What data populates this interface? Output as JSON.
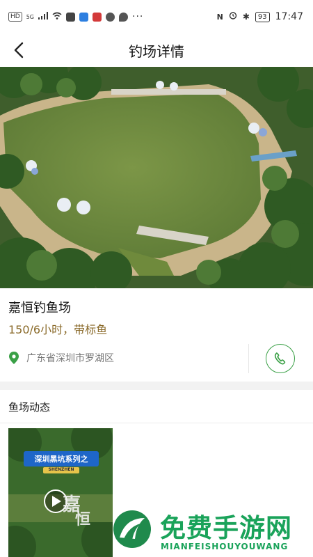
{
  "status_bar": {
    "left_badges": [
      "HD",
      "5G"
    ],
    "battery": "93",
    "time": "17:47"
  },
  "nav": {
    "title": "钓场详情",
    "back_icon": "chevron-left-icon"
  },
  "spot": {
    "name": "嘉恒钓鱼场",
    "price": "150/6小时，带标鱼",
    "address": "广东省深圳市罗湖区",
    "location_icon": "map-pin-icon",
    "phone_icon": "phone-icon"
  },
  "section": {
    "title": "鱼场动态"
  },
  "thumb": {
    "banner": "深圳黑坑系列之",
    "sub": "SHENZHEN"
  },
  "watermark": {
    "title": "免费手游网",
    "sub": "MIANFEISHOUYOUWANG"
  },
  "colors": {
    "accent_green": "#3aa046",
    "price_brown": "#8a6a2a",
    "watermark_green": "#1aa35a"
  }
}
